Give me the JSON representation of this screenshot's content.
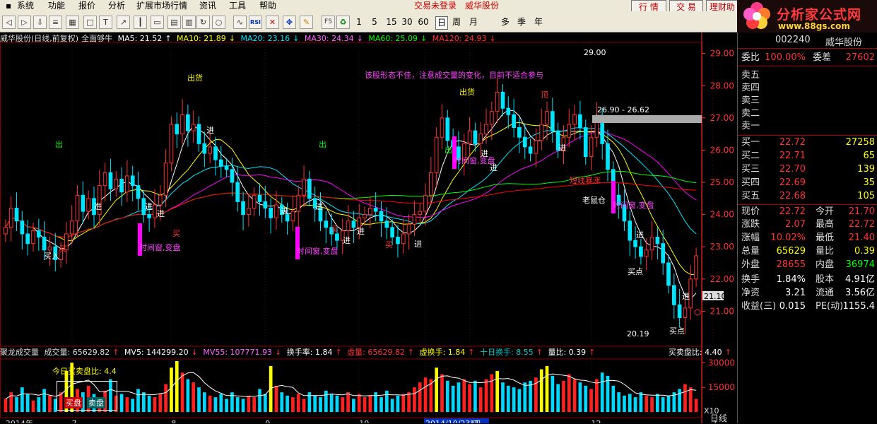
{
  "menu": {
    "items": [
      "系统",
      "功能",
      "报价",
      "分析",
      "扩展市场行情",
      "资讯",
      "工具",
      "帮助"
    ],
    "status_left": "交易未登录",
    "status_right": "威华股份",
    "buttons": [
      "行 情",
      "交 易",
      "理财助"
    ]
  },
  "toolbar": {
    "periods": [
      "1",
      "5",
      "15",
      "30",
      "60",
      "日",
      "周",
      "月",
      "多",
      "季",
      "年"
    ],
    "selected_period": "日",
    "icons": [
      "back-icon",
      "forward-icon",
      "down-arrow-icon",
      "list-icon",
      "grid-icon",
      "fullscreen-icon",
      "text-icon",
      "trend-icon",
      "kline-icon",
      "window-icon",
      "table-icon",
      "multi-chart-icon",
      "refresh-icon",
      "circle-icon",
      "line-chart-icon",
      "rsi-icon",
      "x-icon",
      "move-icon",
      "pencil-icon",
      "f5-icon",
      "recycle-icon"
    ]
  },
  "logo": {
    "title": "分析家公式网",
    "url": "www.88gs.com"
  },
  "colors": {
    "up": "#ff3232",
    "down": "#00e5ff",
    "ma5": "#ffffff",
    "ma10": "#ffff00",
    "ma20": "#ff00ff",
    "ma30": "#00ff00",
    "ma60": "#ff0000",
    "ma120": "#ffff00",
    "grid": "#8b0000",
    "axis": "#ff3232"
  },
  "main_header": {
    "title": "威华股份(日线,前复权)",
    "indicator": "全面够牛",
    "ma": [
      {
        "label": "MA5: 21.52",
        "color": "#ffffff"
      },
      {
        "label": "MA10: 21.89",
        "color": "#ffff00"
      },
      {
        "label": "MA20: 23.16",
        "color": "#00e5ff"
      },
      {
        "label": "MA30: 24.34",
        "color": "#ff66ff"
      },
      {
        "label": "MA60: 25.09",
        "color": "#00ff00"
      },
      {
        "label": "MA120: 24.93",
        "color": "#ff3232"
      }
    ]
  },
  "vol_header": [
    {
      "label": "聚龙成交量",
      "color": "#dddddd"
    },
    {
      "label": "成交量: 65629.82",
      "color": "#dddddd"
    },
    {
      "label": "MV5: 144299.20",
      "color": "#ffffff"
    },
    {
      "label": "MV55: 107771.93",
      "color": "#ff66ff"
    },
    {
      "label": "换手率: 1.84",
      "color": "#ffffff"
    },
    {
      "label": "虚量: 65629.82",
      "color": "#ff3232"
    },
    {
      "label": "虚换手: 1.84",
      "color": "#ffff00"
    },
    {
      "label": "十日换手: 8.55",
      "color": "#00c8c8"
    },
    {
      "label": "量比: 0.39",
      "color": "#ffffff"
    },
    {
      "label": "买卖盘比: 4.40",
      "color": "#ffffff"
    }
  ],
  "vol_box": {
    "title": "今日买卖盘比: 4.4",
    "buy": "买盘",
    "sell": "卖盘"
  },
  "chart_data": {
    "type": "candlestick",
    "title": "威华股份(日线,前复权)",
    "y_ticks": [
      21,
      22,
      23,
      24,
      25,
      26,
      27,
      28,
      29
    ],
    "y_tick_labels": [
      "21.00",
      "22.00",
      "23.00",
      "24.00",
      "25.00",
      "26.00",
      "27.00",
      "28.00",
      "29.00"
    ],
    "ylim": [
      20,
      29.3
    ],
    "vol_ticks": [
      15000,
      30000
    ],
    "vol_tick_labels": [
      "15000",
      "30000"
    ],
    "vol_unit": "X10",
    "vol_max": 34000,
    "x_labels": [
      {
        "label": "2014年",
        "i": 0
      },
      {
        "label": "7",
        "i": 12
      },
      {
        "label": "8",
        "i": 30
      },
      {
        "label": "9",
        "i": 47
      },
      {
        "label": "10",
        "i": 64
      },
      {
        "label": "2014/10/23/四",
        "i": 76
      },
      {
        "label": "11",
        "i": 84
      },
      {
        "label": "12",
        "i": 106
      },
      {
        "label": "1",
        "i": 128
      }
    ],
    "closes": [
      23.6,
      24.2,
      23.8,
      23.4,
      23.1,
      23.5,
      23.3,
      22.9,
      23.0,
      22.6,
      22.9,
      23.4,
      23.8,
      24.6,
      24.1,
      24.5,
      24.0,
      24.9,
      25.3,
      24.8,
      25.1,
      24.7,
      25.2,
      24.9,
      24.5,
      24.0,
      23.9,
      24.3,
      24.6,
      25.6,
      26.8,
      26.5,
      27.1,
      26.6,
      26.8,
      26.2,
      25.9,
      26.1,
      25.7,
      25.5,
      25.4,
      25.0,
      24.4,
      24.0,
      24.2,
      24.6,
      24.4,
      24.2,
      23.9,
      24.3,
      24.0,
      23.8,
      24.1,
      24.6,
      25.1,
      24.5,
      24.2,
      23.8,
      23.6,
      23.4,
      23.2,
      23.5,
      23.8,
      23.6,
      23.9,
      24.0,
      24.2,
      24.1,
      23.8,
      23.6,
      23.3,
      23.1,
      23.4,
      23.7,
      24.0,
      24.1,
      24.6,
      25.3,
      26.4,
      27.0,
      26.3,
      26.1,
      25.7,
      26.2,
      26.6,
      26.2,
      26.5,
      26.8,
      27.2,
      27.8,
      27.3,
      27.1,
      26.7,
      26.4,
      26.1,
      25.9,
      26.3,
      26.8,
      27.2,
      26.6,
      26.0,
      26.4,
      26.8,
      27.1,
      26.7,
      25.8,
      26.4,
      27.0,
      26.2,
      25.4,
      24.6,
      24.3,
      23.8,
      23.2,
      23.0,
      22.7,
      22.9,
      23.3,
      23.1,
      22.5,
      21.8,
      21.2,
      20.8,
      21.1,
      22.0,
      22.72
    ],
    "volumes": [
      8000,
      12000,
      9000,
      15000,
      11000,
      7000,
      9000,
      14000,
      10000,
      8000,
      12000,
      25000,
      30000,
      14000,
      12000,
      16000,
      11000,
      9000,
      13000,
      20000,
      10000,
      11000,
      9000,
      8000,
      14000,
      12000,
      10000,
      9000,
      11000,
      17000,
      27000,
      31000,
      24000,
      20000,
      18000,
      15000,
      12000,
      10000,
      9000,
      11000,
      8000,
      12000,
      9000,
      8000,
      10000,
      9000,
      14000,
      11000,
      28000,
      16000,
      12000,
      10000,
      9000,
      11000,
      8000,
      12000,
      10000,
      9000,
      13000,
      11000,
      10000,
      9000,
      12000,
      8000,
      11000,
      9000,
      10000,
      12000,
      9000,
      13000,
      8000,
      10000,
      11000,
      12000,
      15000,
      18000,
      21000,
      20000,
      27000,
      23000,
      19000,
      16000,
      18000,
      20000,
      17000,
      19000,
      15000,
      20000,
      23000,
      25000,
      18000,
      16000,
      15000,
      14000,
      18000,
      19000,
      21000,
      26000,
      28000,
      22000,
      17000,
      19000,
      23000,
      20000,
      18000,
      16000,
      14000,
      20000,
      24000,
      22000,
      16000,
      12000,
      10000,
      11000,
      9000,
      12000,
      10000,
      9000,
      11000,
      9000,
      10000,
      12000,
      14000,
      17000,
      15000,
      8000
    ],
    "annotations": [
      {
        "text": "该股形态不佳，注意成交量的变化，目前不适合参与",
        "color": "#ff44ff"
      },
      {
        "text": "出货",
        "color": "#ffff00"
      },
      {
        "text": "出货",
        "color": "#ffff00"
      },
      {
        "text": "出",
        "color": "#00ff00"
      },
      {
        "text": "出",
        "color": "#00ff00"
      },
      {
        "text": "出",
        "color": "#00ff00"
      },
      {
        "text": "进",
        "color": "#ffffff"
      },
      {
        "text": "买入",
        "color": "#ffffff"
      },
      {
        "text": "买",
        "color": "#ff3232"
      },
      {
        "text": "时间窗,变盘",
        "color": "#ff44ff"
      },
      {
        "text": "顶",
        "color": "#ff3232"
      },
      {
        "text": "29.00",
        "color": "#ffffff"
      },
      {
        "text": "26.90 - 26.62",
        "color": "#ffffff"
      },
      {
        "text": "短线暴涨",
        "color": "#ff3232"
      },
      {
        "text": "老鼠仓",
        "color": "#ffffff"
      },
      {
        "text": "买点",
        "color": "#ffffff"
      },
      {
        "text": "20.19",
        "color": "#ffffff"
      },
      {
        "text": "21.10",
        "color": "#ffffff"
      }
    ]
  },
  "quote": {
    "code": "002240",
    "name": "威华股份",
    "weibi_label": "委比",
    "weibi": "100.00%",
    "weicha_label": "委差",
    "weicha": "27602",
    "sell": [
      {
        "label": "卖五",
        "price": "",
        "vol": ""
      },
      {
        "label": "卖四",
        "price": "",
        "vol": ""
      },
      {
        "label": "卖三",
        "price": "",
        "vol": ""
      },
      {
        "label": "卖二",
        "price": "",
        "vol": ""
      },
      {
        "label": "卖一",
        "price": "",
        "vol": ""
      }
    ],
    "buy": [
      {
        "label": "买一",
        "price": "22.72",
        "vol": "27258"
      },
      {
        "label": "买二",
        "price": "22.71",
        "vol": "65"
      },
      {
        "label": "买三",
        "price": "22.70",
        "vol": "139"
      },
      {
        "label": "买四",
        "price": "22.69",
        "vol": "35"
      },
      {
        "label": "买五",
        "price": "22.68",
        "vol": "105"
      }
    ],
    "stats": [
      {
        "k1": "现价",
        "v1": "22.72",
        "c1": "#ff3232",
        "k2": "今开",
        "v2": "21.70",
        "c2": "#ff3232"
      },
      {
        "k1": "涨跌",
        "v1": "2.07",
        "c1": "#ff3232",
        "k2": "最高",
        "v2": "22.72",
        "c2": "#ff3232"
      },
      {
        "k1": "涨幅",
        "v1": "10.02%",
        "c1": "#ff3232",
        "k2": "最低",
        "v2": "21.40",
        "c2": "#ff3232"
      },
      {
        "k1": "总量",
        "v1": "65629",
        "c1": "#ffff00",
        "k2": "量比",
        "v2": "0.39",
        "c2": "#ffff00"
      },
      {
        "k1": "外盘",
        "v1": "28655",
        "c1": "#ff3232",
        "k2": "内盘",
        "v2": "36974",
        "c2": "#00ff00"
      },
      {
        "k1": "换手",
        "v1": "1.84%",
        "c1": "#ffffff",
        "k2": "股本",
        "v2": "4.91亿",
        "c2": "#ffffff"
      },
      {
        "k1": "净资",
        "v1": "3.21",
        "c1": "#ffffff",
        "k2": "流通",
        "v2": "3.56亿",
        "c2": "#ffffff"
      },
      {
        "k1": "收益(三)",
        "v1": "0.015",
        "c1": "#ffffff",
        "k2": "PE(动)",
        "v2": "1155.4",
        "c2": "#ffffff"
      }
    ]
  },
  "bottom_tab": "日线"
}
